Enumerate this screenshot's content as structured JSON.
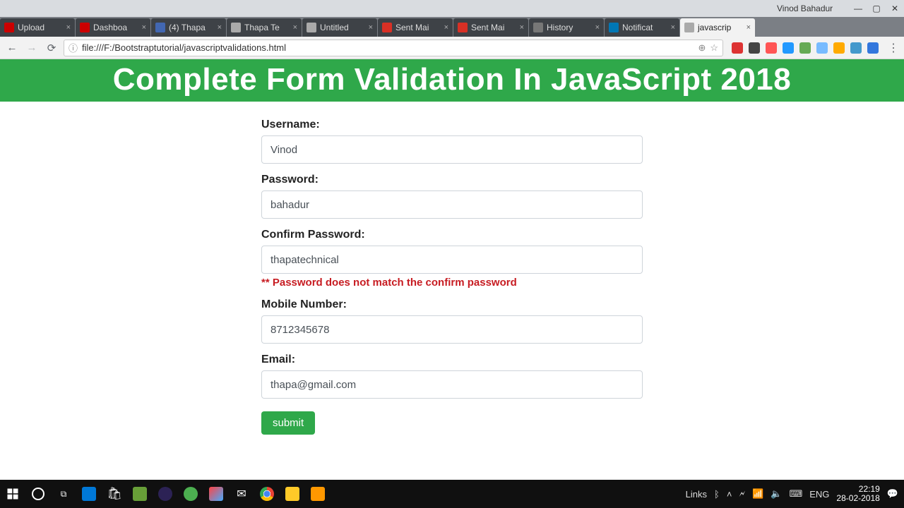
{
  "window": {
    "user_label": "Vinod Bahadur"
  },
  "tabs": [
    {
      "label": "Upload",
      "favclass": "fav-yt"
    },
    {
      "label": "Dashboa",
      "favclass": "fav-yt"
    },
    {
      "label": "(4) Thapa",
      "favclass": "fav-fb"
    },
    {
      "label": "Thapa Te",
      "favclass": "fav-gen"
    },
    {
      "label": "Untitled",
      "favclass": "fav-gen"
    },
    {
      "label": "Sent Mai",
      "favclass": "fav-gm"
    },
    {
      "label": "Sent Mai",
      "favclass": "fav-gm"
    },
    {
      "label": "History",
      "favclass": "fav-hi"
    },
    {
      "label": "Notificat",
      "favclass": "fav-li"
    },
    {
      "label": "javascrip",
      "favclass": "fav-gen",
      "active": true
    }
  ],
  "address": {
    "url": "file:///F:/Bootstraptutorial/javascriptvalidations.html"
  },
  "ext_colors": [
    "#d33",
    "#444",
    "#f55",
    "#29f",
    "#6a5",
    "#7bf",
    "#fa0",
    "#49c",
    "#37d"
  ],
  "page": {
    "banner": "Complete Form Validation In JavaScript 2018",
    "fields": {
      "username": {
        "label": "Username:",
        "value": "Vinod"
      },
      "password": {
        "label": "Password:",
        "value": "bahadur"
      },
      "confirm": {
        "label": "Confirm Password:",
        "value": "thapatechnical",
        "error": "** Password does not match the confirm password"
      },
      "mobile": {
        "label": "Mobile Number:",
        "value": "8712345678"
      },
      "email": {
        "label": "Email:",
        "value": "thapa@gmail.com"
      }
    },
    "submit_label": "submit"
  },
  "taskbar": {
    "links_label": "Links",
    "lang": "ENG",
    "time": "22:19",
    "date": "28-02-2018"
  }
}
